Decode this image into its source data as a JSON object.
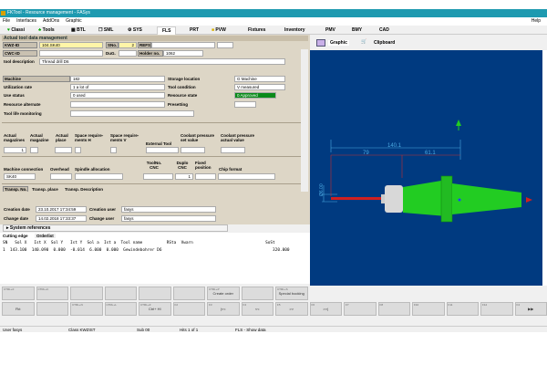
{
  "window": {
    "title": "FKTool - Resource management - FASys"
  },
  "menu": [
    "File",
    "Interfaces",
    "AddOns",
    "Graphic"
  ],
  "tabs": [
    "Classi",
    "Tools",
    "BTL",
    "SML",
    "SYS",
    "FLS",
    "PRT",
    "PVW",
    "Fixtures",
    "Inventory",
    "PMV",
    "BMY",
    "CAD"
  ],
  "active_tab": "FLS",
  "help_label": "Help",
  "section_title": "Actual tool data management",
  "header_fields": {
    "kwz_label": "KWZ-ID",
    "kwz_value": "104.SK40",
    "sno_label": "SNo.",
    "sno_value": "2",
    "refs_label": "REFS",
    "refs_value": "",
    "cwc_label": "CWC-ID",
    "cwc_value": "",
    "dug_label": "DuG.",
    "dug_value": "",
    "holder_label": "Holder no.",
    "holder_value": "1062",
    "desc_label": "tool description",
    "desc_value": "Thread drill D6"
  },
  "details": {
    "machine_label": "Machine",
    "machine_value": "182",
    "storage_label": "Storage location",
    "storage_value": "G Machine",
    "util_label": "Utilization rate",
    "util_value": "1 a lot of",
    "condition_label": "Tool condition",
    "condition_value": "V measured",
    "use_label": "Use status",
    "use_value": "0 used",
    "resstate_label": "Resource state",
    "resstate_value": "0 Approved",
    "alt_label": "Resource alternate",
    "preset_label": "Presetting",
    "life_label": "Tool life monitoring"
  },
  "magazine": {
    "labels": [
      "Actual magazines",
      "Actual magazine",
      "Actual place",
      "Space require-ments H",
      "Space require-ments V",
      "External Tool",
      "Coolant pressure set value",
      "Coolant pressure actual value"
    ],
    "actual_magazines": "1"
  },
  "connection": {
    "labels": [
      "Machine connection",
      "Overhead",
      "Spindle allocation",
      "ToolNo. CNC",
      "Duplo CNC",
      "Fixed position",
      "Chip format"
    ],
    "machine_connection": "SK40",
    "duplo": "1"
  },
  "transport": {
    "labels": [
      "Transp. No.",
      "Transp. place",
      "Transp. Description"
    ]
  },
  "dates": {
    "creation_date_label": "Creation date",
    "creation_date": "23.10.2017 17:34:59",
    "creation_user_label": "Creation user",
    "creation_user": "fasys",
    "change_date_label": "Change date",
    "change_date": "14.02.2018 17:33:37",
    "change_user_label": "Change user",
    "change_user": "fasys",
    "system_refs": "System references"
  },
  "grid_tabs": [
    "Cutting edge",
    "Orderlist"
  ],
  "grid": {
    "header": "SN   Sol X   Ist X  Sol Y   Ist Y  Sol a  Ist a  Tool name          RSta  Vwarn                              SoSt",
    "rows": [
      "1  143.100  140.090  0.000  -0.014  6.000  0.000  Gewindebohrer D6                                              320.000"
    ]
  },
  "graphic_tabs": [
    "Graphic",
    "Clipboard"
  ],
  "dimensions": {
    "total": "140.1",
    "left": "79",
    "right": "61.1",
    "diameter": "Ø6.00"
  },
  "buttons_row1": [
    {
      "key": "CTRL+F",
      "label": ""
    },
    {
      "key": "CTRL+C",
      "label": ""
    },
    {
      "key": "",
      "label": ""
    },
    {
      "key": "",
      "label": ""
    },
    {
      "key": "",
      "label": ""
    },
    {
      "key": "",
      "label": ""
    },
    {
      "key": "CTRL+P",
      "label": "Create order"
    },
    {
      "key": "",
      "label": ""
    },
    {
      "key": "CTRL+S",
      "label": "Special booking"
    }
  ],
  "buttons_row2": [
    {
      "key": "",
      "label": "Fkt"
    },
    {
      "key": "",
      "label": ""
    },
    {
      "key": "CTRL+N",
      "label": ""
    },
    {
      "key": "CTRL+L",
      "label": ""
    },
    {
      "key": "CTRL+Z",
      "label": "Ctrl+ Hl"
    },
    {
      "key": "F2",
      "label": ""
    },
    {
      "key": "F3",
      "label": "|<<"
    },
    {
      "key": "F4",
      "label": "<<"
    },
    {
      "key": "F5",
      "label": ">>"
    },
    {
      "key": "F6",
      "label": ">>|"
    },
    {
      "key": "F7",
      "label": ""
    },
    {
      "key": "F8",
      "label": ""
    },
    {
      "key": "F10",
      "label": ""
    },
    {
      "key": "F11",
      "label": ""
    },
    {
      "key": "F12",
      "label": ""
    },
    {
      "key": "F4",
      "label": "▶▶"
    }
  ],
  "status": {
    "user": "User fasys",
    "class": "Class KWZIST",
    "sub": "Sub 00",
    "hits": "Hits 1 of 1",
    "mode": "FLS - Show data"
  },
  "colors": {
    "titlebar": "#1e9ab0",
    "panel": "#ddd6c6",
    "canvas": "#003a80",
    "tool_green": "#22cc22",
    "approved": "#0a8a1a"
  }
}
